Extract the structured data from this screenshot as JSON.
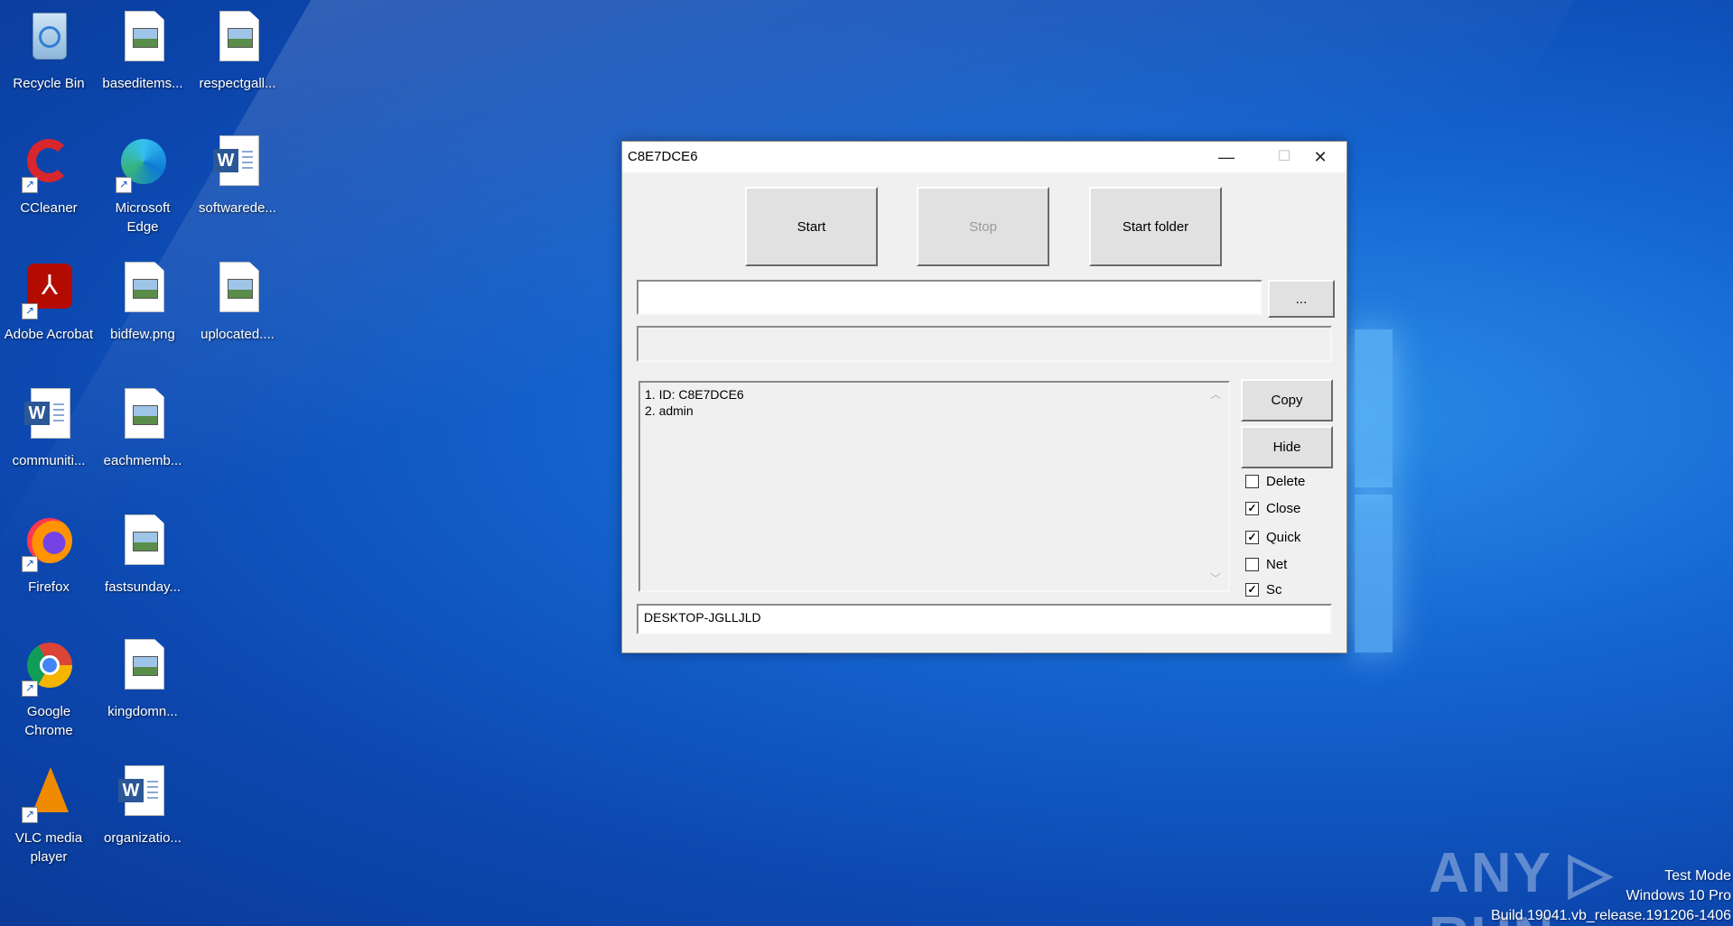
{
  "desktop": {
    "icons": [
      {
        "label": "Recycle Bin",
        "icon": "recycle-bin-icon"
      },
      {
        "label": "baseditems...",
        "icon": "image-file-icon"
      },
      {
        "label": "respectgall...",
        "icon": "image-file-icon"
      },
      {
        "label": "CCleaner",
        "icon": "ccleaner-icon"
      },
      {
        "label": "Microsoft Edge",
        "icon": "edge-icon"
      },
      {
        "label": "softwarede...",
        "icon": "word-document-icon"
      },
      {
        "label": "Adobe Acrobat",
        "icon": "acrobat-icon"
      },
      {
        "label": "bidfew.png",
        "icon": "image-file-icon"
      },
      {
        "label": "uplocated....",
        "icon": "image-file-icon"
      },
      {
        "label": "communiti...",
        "icon": "word-document-icon"
      },
      {
        "label": "eachmemb...",
        "icon": "image-file-icon"
      },
      {
        "label": "Firefox",
        "icon": "firefox-icon"
      },
      {
        "label": "fastsunday...",
        "icon": "image-file-icon"
      },
      {
        "label": "Google Chrome",
        "icon": "chrome-icon"
      },
      {
        "label": "kingdomn...",
        "icon": "image-file-icon"
      },
      {
        "label": "VLC media player",
        "icon": "vlc-icon"
      },
      {
        "label": "organizatio...",
        "icon": "word-document-icon"
      }
    ]
  },
  "window": {
    "title": "C8E7DCE6",
    "minimize_glyph": "—",
    "maximize_glyph": "☐",
    "close_glyph": "✕",
    "buttons": {
      "start": "Start",
      "stop": "Stop",
      "start_folder": "Start folder",
      "browse": "...",
      "copy": "Copy",
      "hide": "Hide"
    },
    "path_input": "",
    "progress_field": "",
    "log_lines": [
      "1. ID: C8E7DCE6",
      "2. admin"
    ],
    "checkboxes": [
      {
        "label": "Delete",
        "checked": false
      },
      {
        "label": "Close",
        "checked": true
      },
      {
        "label": "Quick",
        "checked": true
      },
      {
        "label": "Net",
        "checked": false
      },
      {
        "label": "Sc",
        "checked": true
      }
    ],
    "status_text": "DESKTOP-JGLLJLD"
  },
  "watermark": {
    "brand": "ANY RUN",
    "line1": "Test Mode",
    "line2": "Windows 10 Pro",
    "line3": "Build 19041.vb_release.191206-1406"
  }
}
